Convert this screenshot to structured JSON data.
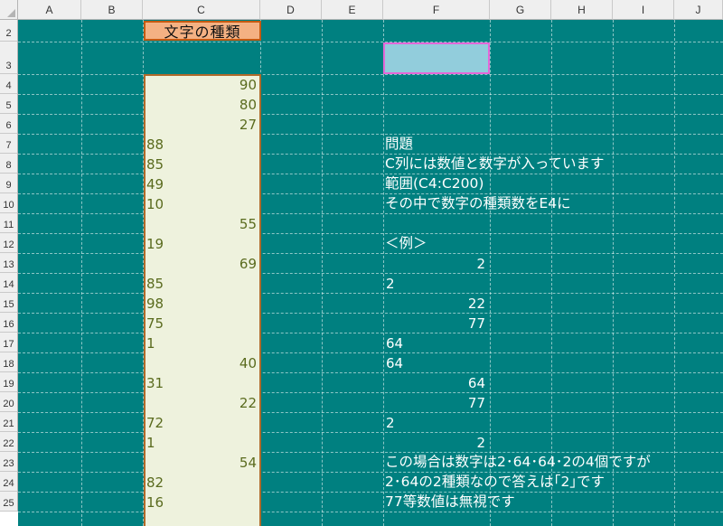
{
  "columns": [
    "A",
    "B",
    "C",
    "D",
    "E",
    "F",
    "G",
    "H",
    "I",
    "J"
  ],
  "rows": [
    "2",
    "3",
    "4",
    "5",
    "6",
    "7",
    "8",
    "9",
    "10",
    "11",
    "12",
    "13",
    "14",
    "15",
    "16",
    "17",
    "18",
    "19",
    "20",
    "21",
    "22",
    "23",
    "24",
    "25"
  ],
  "c_header": "文字の種類",
  "c_values": [
    {
      "row": "4",
      "value": "90",
      "align": "right"
    },
    {
      "row": "5",
      "value": "80",
      "align": "right"
    },
    {
      "row": "6",
      "value": "27",
      "align": "right"
    },
    {
      "row": "7",
      "value": "88",
      "align": "left"
    },
    {
      "row": "8",
      "value": "85",
      "align": "left"
    },
    {
      "row": "9",
      "value": "49",
      "align": "left"
    },
    {
      "row": "10",
      "value": "10",
      "align": "left"
    },
    {
      "row": "11",
      "value": "55",
      "align": "right"
    },
    {
      "row": "12",
      "value": "19",
      "align": "left"
    },
    {
      "row": "13",
      "value": "69",
      "align": "right"
    },
    {
      "row": "14",
      "value": "85",
      "align": "left"
    },
    {
      "row": "15",
      "value": "98",
      "align": "left"
    },
    {
      "row": "16",
      "value": "75",
      "align": "left"
    },
    {
      "row": "17",
      "value": "1",
      "align": "left"
    },
    {
      "row": "18",
      "value": "40",
      "align": "right"
    },
    {
      "row": "19",
      "value": "31",
      "align": "left"
    },
    {
      "row": "20",
      "value": "22",
      "align": "right"
    },
    {
      "row": "21",
      "value": "72",
      "align": "left"
    },
    {
      "row": "22",
      "value": "1",
      "align": "left"
    },
    {
      "row": "23",
      "value": "54",
      "align": "right"
    },
    {
      "row": "24",
      "value": "82",
      "align": "left"
    },
    {
      "row": "25",
      "value": "16",
      "align": "left"
    }
  ],
  "f_text": [
    {
      "row": "7",
      "text": "問題"
    },
    {
      "row": "8",
      "text": "C列には数値と数字が入っています"
    },
    {
      "row": "9",
      "text": "範囲(C4:C200)"
    },
    {
      "row": "10",
      "text": "その中で数字の種類数をE4に"
    },
    {
      "row": "12",
      "text": "＜例＞"
    },
    {
      "row": "23",
      "text": "この場合は数字は2･64･64･2の4個ですが"
    },
    {
      "row": "24",
      "text": "2･64の2種類なので答えは｢2｣です"
    },
    {
      "row": "25",
      "text": "77等数値は無視です"
    }
  ],
  "f_values": [
    {
      "row": "13",
      "value": "2",
      "align": "right"
    },
    {
      "row": "14",
      "value": "2",
      "align": "left"
    },
    {
      "row": "15",
      "value": "22",
      "align": "right"
    },
    {
      "row": "16",
      "value": "77",
      "align": "right"
    },
    {
      "row": "17",
      "value": "64",
      "align": "left"
    },
    {
      "row": "18",
      "value": "64",
      "align": "left"
    },
    {
      "row": "19",
      "value": "64",
      "align": "right"
    },
    {
      "row": "20",
      "value": "77",
      "align": "right"
    },
    {
      "row": "21",
      "value": "2",
      "align": "left"
    },
    {
      "row": "22",
      "value": "2",
      "align": "right"
    }
  ],
  "colors": {
    "sheet_bg": "#008080",
    "c_fill": "#eef2dd",
    "header_fill": "#f4b183",
    "answer_fill": "#92cddc",
    "answer_border": "#e466d8"
  }
}
